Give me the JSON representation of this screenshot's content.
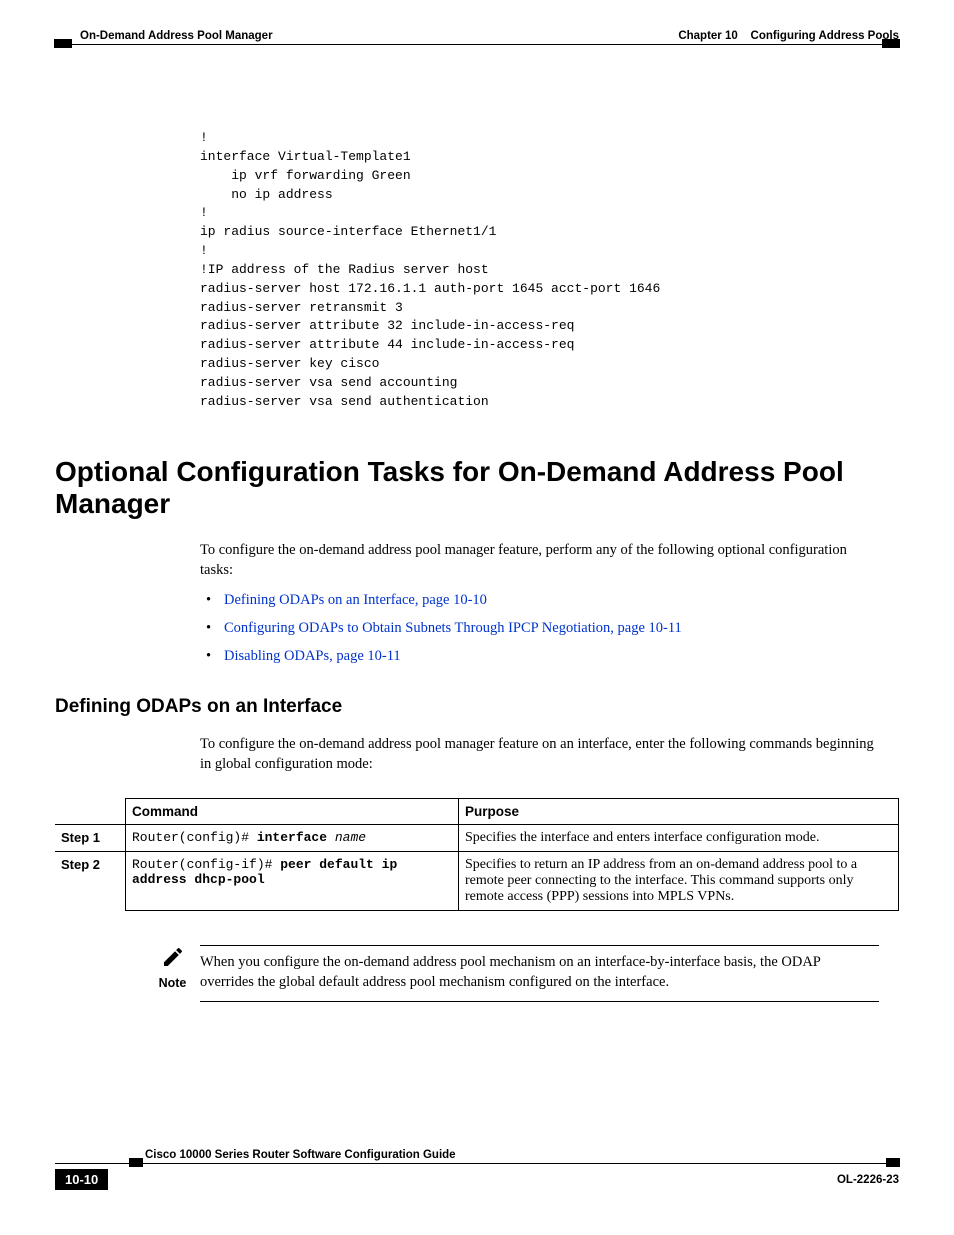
{
  "header": {
    "section": "On-Demand Address Pool Manager",
    "chapter_label": "Chapter 10",
    "chapter_title": "Configuring Address Pools"
  },
  "code": "!\ninterface Virtual-Template1\n    ip vrf forwarding Green\n    no ip address\n!\nip radius source-interface Ethernet1/1\n!\n!IP address of the Radius server host\nradius-server host 172.16.1.1 auth-port 1645 acct-port 1646\nradius-server retransmit 3\nradius-server attribute 32 include-in-access-req\nradius-server attribute 44 include-in-access-req\nradius-server key cisco\nradius-server vsa send accounting\nradius-server vsa send authentication",
  "h1": "Optional Configuration Tasks for On-Demand Address Pool Manager",
  "intro": "To configure the on-demand address pool manager feature, perform any of the following optional configuration tasks:",
  "links": [
    "Defining ODAPs on an Interface, page 10-10",
    "Configuring ODAPs to Obtain Subnets Through IPCP Negotiation, page 10-11",
    "Disabling ODAPs, page 10-11"
  ],
  "h2": "Defining ODAPs on an Interface",
  "h2_intro": "To configure the on-demand address pool manager feature on an interface, enter the following commands beginning in global configuration mode:",
  "table": {
    "headers": {
      "col1": "",
      "col2": "Command",
      "col3": "Purpose"
    },
    "rows": [
      {
        "step": "Step 1",
        "cmd_prefix": "Router(config)# ",
        "cmd_bold": "interface",
        "cmd_ital": " name",
        "cmd_suffix": "",
        "purpose": "Specifies the interface and enters interface configuration mode."
      },
      {
        "step": "Step 2",
        "cmd_prefix": "Router(config-if)# ",
        "cmd_bold": "peer default ip address dhcp-pool",
        "cmd_ital": "",
        "cmd_suffix": "",
        "purpose": "Specifies to return an IP address from an on-demand address pool to a remote peer connecting to the interface. This command supports only remote access (PPP) sessions into MPLS VPNs."
      }
    ]
  },
  "note": {
    "label": "Note",
    "text": "When you configure the on-demand address pool mechanism on an interface-by-interface basis, the ODAP overrides the global default address pool mechanism configured on the interface."
  },
  "footer": {
    "guide": "Cisco 10000 Series Router Software Configuration Guide",
    "page": "10-10",
    "doc_id": "OL-2226-23"
  }
}
